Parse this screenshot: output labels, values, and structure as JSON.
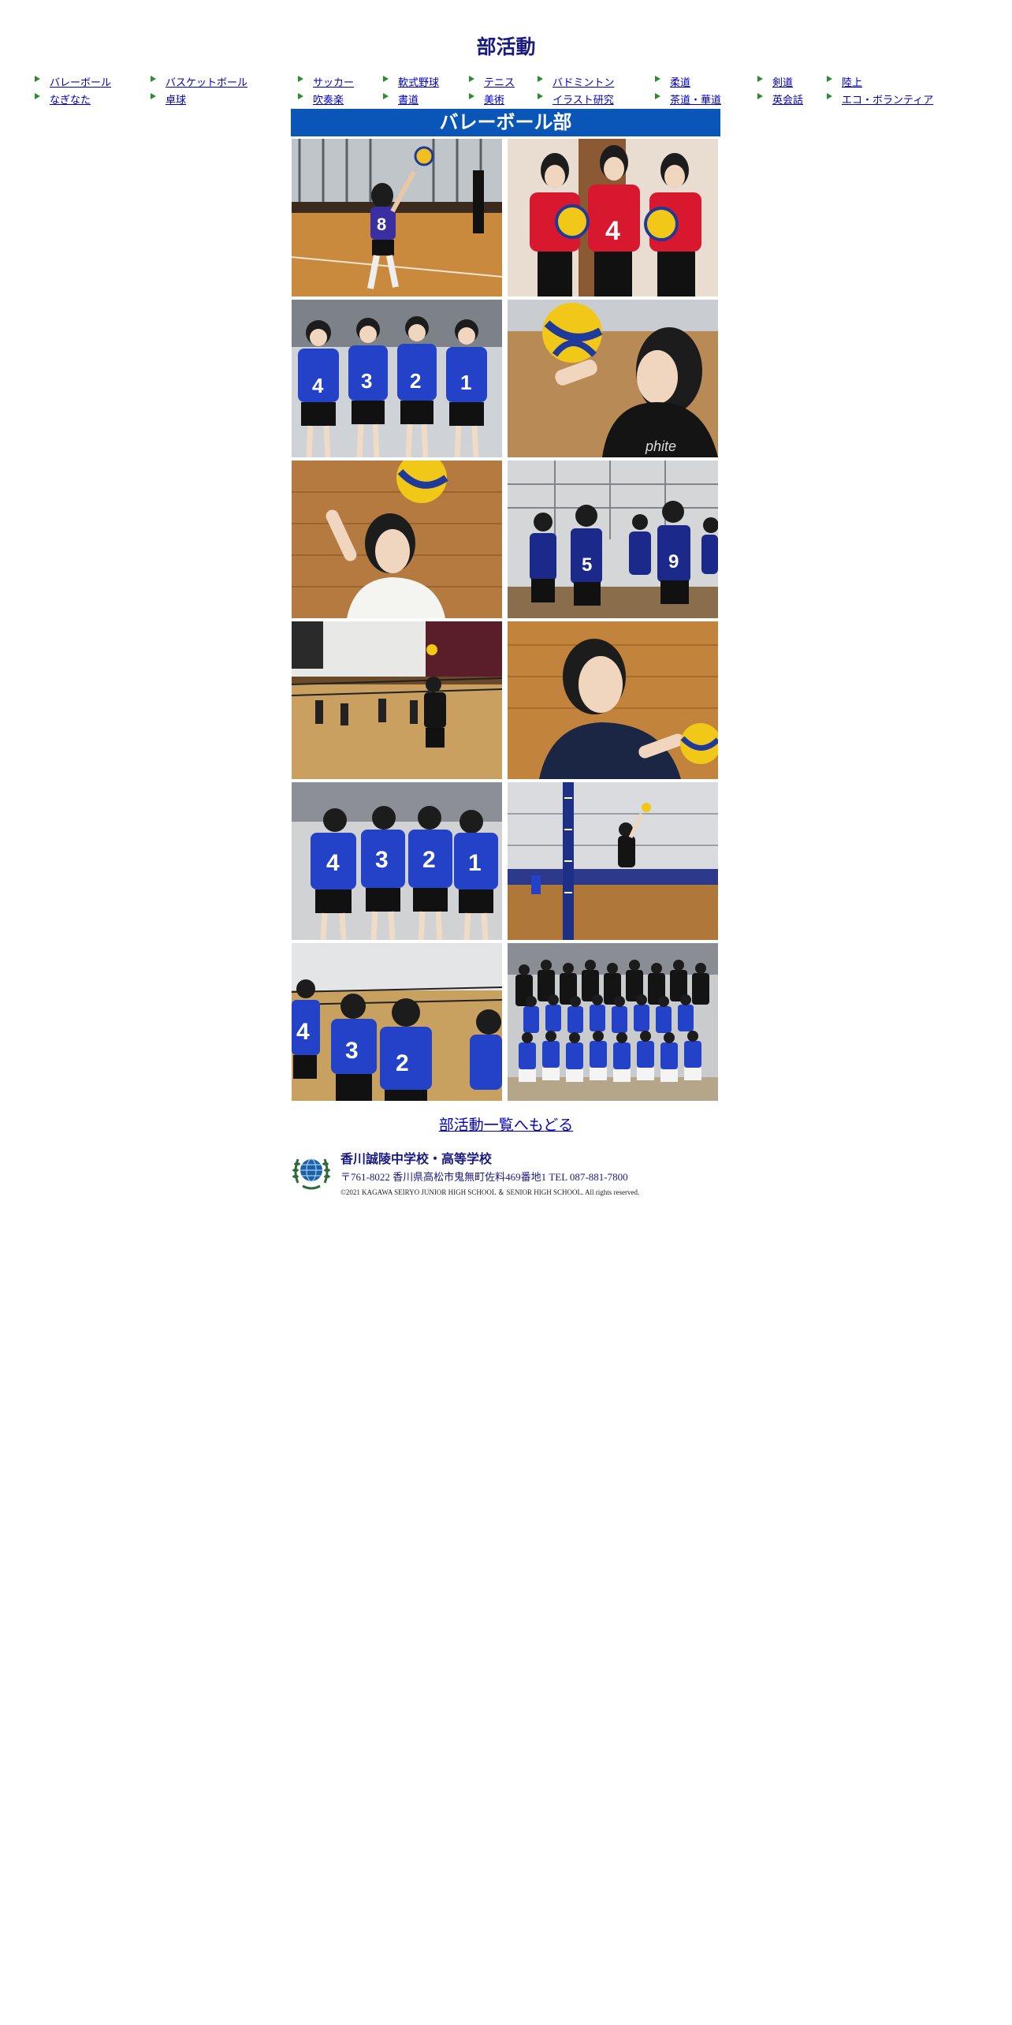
{
  "page": {
    "title": "部活動"
  },
  "nav": {
    "clubs": [
      "バレーボール",
      "バスケットボール",
      "サッカー",
      "軟式野球",
      "テニス",
      "バドミントン",
      "柔道",
      "剣道",
      "陸上",
      "なぎなた",
      "卓球",
      "吹奏楽",
      "書道",
      "美術",
      "イラスト研究",
      "茶道・華道",
      "英会話",
      "エコ・ボランティア"
    ]
  },
  "club": {
    "name": "バレーボール部"
  },
  "photos": [
    "action-photo-serve",
    "team-photo-red-uniforms",
    "team-photo-blue-uniforms",
    "portrait-ball-toss",
    "portrait-overhead-set",
    "team-photo-court",
    "gym-match-spike",
    "portrait-smiling-ball",
    "team-photo-backs",
    "net-jump-spike",
    "team-photo-line-up",
    "group-photo-full-team"
  ],
  "links": {
    "back": "部活動一覧へもどる"
  },
  "footer": {
    "school_name": "香川誠陵中学校・高等学校",
    "address": "〒761-8022 香川県高松市鬼無町佐料469番地1 TEL 087-881-7800",
    "copyright": "©2021 KAGAWA SEIRYO JUNIOR HIGH SCHOOL ＆ SENIOR HIGH SCHOOL. All rights reserved."
  },
  "colors": {
    "header_bg": "#0a56b8",
    "title": "#1a1a80",
    "link": "#0000cc",
    "arrow": "#2e8b2e"
  }
}
